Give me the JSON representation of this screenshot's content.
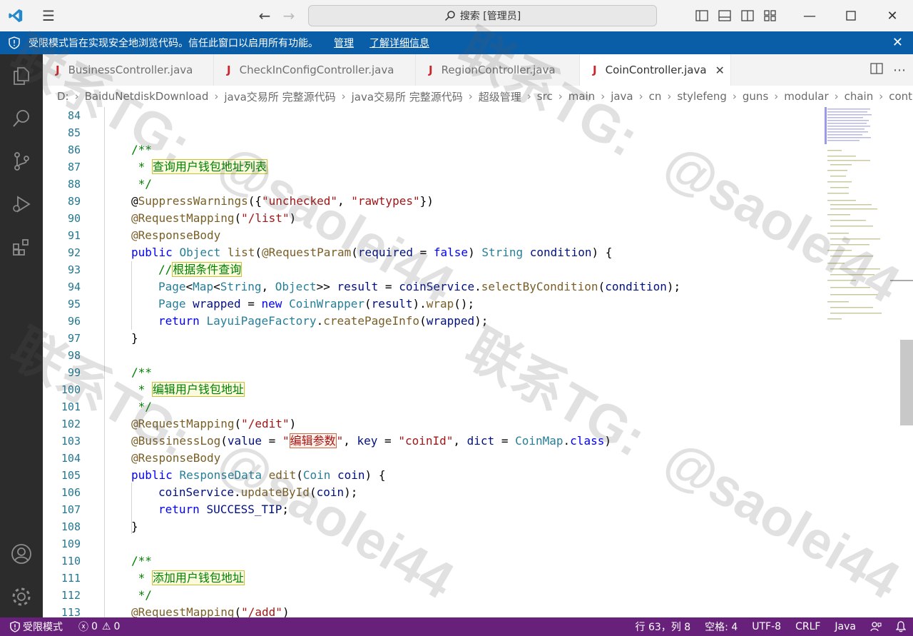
{
  "titlebar": {
    "search_text": "搜索 [管理员]"
  },
  "banner": {
    "message": "受限模式旨在实现安全地浏览代码。信任此窗口以启用所有功能。",
    "manage_label": "管理",
    "learn_more_label": "了解详细信息"
  },
  "tabs": [
    {
      "label": "BusinessController.java",
      "active": false
    },
    {
      "label": "CheckInConfigController.java",
      "active": false
    },
    {
      "label": "RegionController.java",
      "active": false
    },
    {
      "label": "CoinController.java",
      "active": true
    }
  ],
  "tab_icon_letter": "J",
  "breadcrumb": [
    "D:",
    "BaiduNetdiskDownload",
    "java交易所 完整源代码",
    "java交易所 完整源代码",
    "超级管理",
    "src",
    "main",
    "java",
    "cn",
    "stylefeng",
    "guns",
    "modular",
    "chain",
    "controller"
  ],
  "line_numbers": [
    "84",
    "85",
    "86",
    "87",
    "88",
    "89",
    "90",
    "91",
    "92",
    "93",
    "94",
    "95",
    "96",
    "97",
    "98",
    "99",
    "100",
    "101",
    "102",
    "103",
    "104",
    "105",
    "106",
    "107",
    "108",
    "109",
    "110",
    "111",
    "112",
    "113"
  ],
  "code": {
    "c86": "/**",
    "c87_star": " * ",
    "c87_text": "查询用户钱包地址列表",
    "c88": " */",
    "c89_at": "@",
    "c89_ann": "SuppressWarnings",
    "c89_open": "({",
    "c89_s1": "\"unchecked\"",
    "c89_comma": ", ",
    "c89_s2": "\"rawtypes\"",
    "c89_close": "})",
    "c90_ann": "@RequestMapping",
    "c90_str": "\"/list\"",
    "c91_ann": "@ResponseBody",
    "c92_public": "public",
    "c92_type": "Object",
    "c92_fn": "list",
    "c92_ann": "@RequestParam",
    "c92_req": "required",
    "c92_false": "false",
    "c92_type2": "String",
    "c92_cond": "condition",
    "c93_slashes": "//",
    "c93_text": "根据条件查询",
    "c94_page": "Page",
    "c94_map": "Map",
    "c94_string": "String",
    "c94_object": "Object",
    "c94_result": "result",
    "c94_service": "coinService",
    "c94_fn": "selectByCondition",
    "c94_arg": "condition",
    "c95_page": "Page",
    "c95_wrapped": "wrapped",
    "c95_new": "new",
    "c95_wrapper": "CoinWrapper",
    "c95_result": "result",
    "c95_wrap": "wrap",
    "c96_return": "return",
    "c96_factory": "LayuiPageFactory",
    "c96_fn": "createPageInfo",
    "c96_arg": "wrapped",
    "c97": "}",
    "c99": "/**",
    "c100_star": " * ",
    "c100_text": "编辑用户钱包地址",
    "c101": " */",
    "c102_ann": "@RequestMapping",
    "c102_str": "\"/edit\"",
    "c103_ann": "@BussinessLog",
    "c103_value": "value",
    "c103_q1": "\"",
    "c103_cn": "编辑参数",
    "c103_q2": "\"",
    "c103_key": "key",
    "c103_keystr": "\"coinId\"",
    "c103_dict": "dict",
    "c103_map": "CoinMap",
    "c103_class": "class",
    "c104_ann": "@ResponseBody",
    "c105_public": "public",
    "c105_type": "ResponseData",
    "c105_fn": "edit",
    "c105_ptype": "Coin",
    "c105_pname": "coin",
    "c106_service": "coinService",
    "c106_fn": "updateById",
    "c106_arg": "coin",
    "c107_return": "return",
    "c107_tip": "SUCCESS_TIP",
    "c108": "}",
    "c110": "/**",
    "c111_star": " * ",
    "c111_text": "添加用户钱包地址",
    "c112": " */",
    "c113_ann": "@RequestMapping",
    "c113_str": "\"/add\""
  },
  "watermarks": [
    "联系TG:",
    "@saolei44",
    "联系TG:",
    "@saolei44",
    "联系TG:",
    "@saolei44",
    "联系TG:",
    "@saolei44"
  ],
  "status": {
    "restricted": "受限模式",
    "errors": "0",
    "warnings": "0",
    "position": "行 63，列 8",
    "spaces": "空格: 4",
    "encoding": "UTF-8",
    "eol": "CRLF",
    "language": "Java"
  },
  "colors": {
    "banner": "#0a5ea8",
    "status_bar": "#68217a",
    "activity_bar": "#2c2c2c",
    "vscode_blue": "#2489ca",
    "java_icon": "#c8262c"
  }
}
